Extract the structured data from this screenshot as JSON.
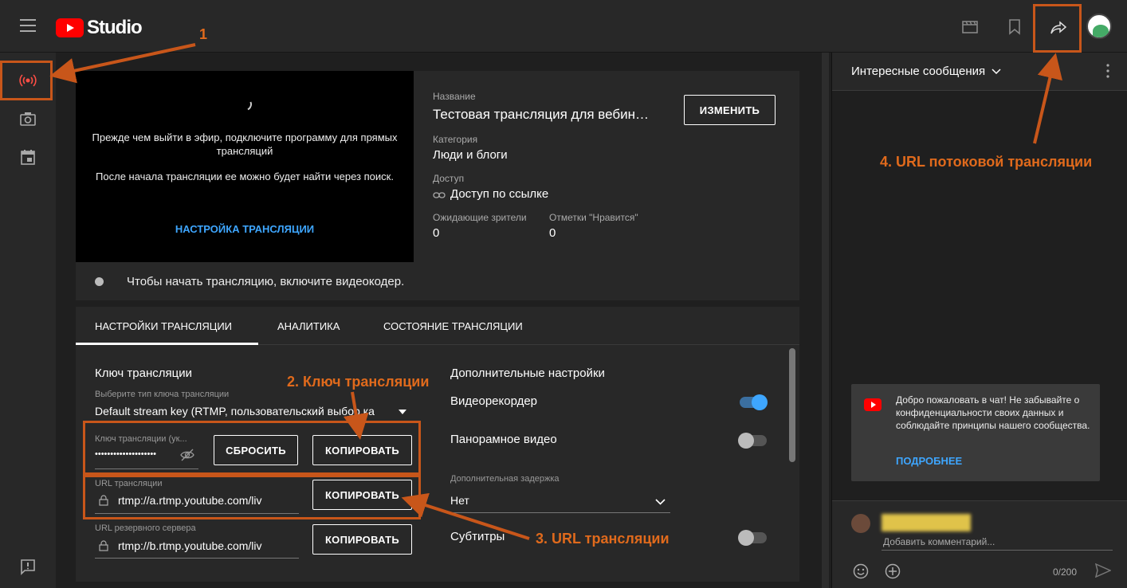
{
  "topbar": {
    "brand": "Studio"
  },
  "preview": {
    "line1": "Прежде чем выйти в эфир, подключите программу для прямых трансляций",
    "line2": "После начала трансляции ее можно будет найти через поиск.",
    "setup_link": "НАСТРОЙКА ТРАНСЛЯЦИИ"
  },
  "meta": {
    "title_label": "Название",
    "title_value": "Тестовая трансляция для вебин…",
    "edit_button": "ИЗМЕНИТЬ",
    "category_label": "Категория",
    "category_value": "Люди и блоги",
    "access_label": "Доступ",
    "access_value": "Доступ по ссылке",
    "waiting_label": "Ожидающие зрители",
    "waiting_value": "0",
    "likes_label": "Отметки \"Нравится\"",
    "likes_value": "0"
  },
  "status": {
    "text": "Чтобы начать трансляцию, включите видеокодер."
  },
  "tabs": [
    "НАСТРОЙКИ ТРАНСЛЯЦИИ",
    "АНАЛИТИКА",
    "СОСТОЯНИЕ ТРАНСЛЯЦИИ"
  ],
  "stream_key": {
    "section_title": "Ключ трансляции",
    "type_label": "Выберите тип ключа трансляции",
    "type_value": "Default stream key (RTMP, пользовательский выбор ка",
    "key_label": "Ключ трансляции (ук...",
    "key_value": "••••••••••••••••••••",
    "reset_button": "СБРОСИТЬ",
    "copy_button": "КОПИРОВАТЬ",
    "url_label": "URL трансляции",
    "url_value": "rtmp://a.rtmp.youtube.com/liv",
    "url_copy_button": "КОПИРОВАТЬ",
    "backup_label": "URL резервного сервера",
    "backup_value": "rtmp://b.rtmp.youtube.com/liv",
    "backup_copy_button": "КОПИРОВАТЬ"
  },
  "extra": {
    "section_title": "Дополнительные настройки",
    "dvr_label": "Видеорекордер",
    "dvr_on": true,
    "panorama_label": "Панорамное видео",
    "panorama_on": false,
    "latency_label": "Дополнительная задержка",
    "latency_value": "Нет",
    "subtitles_label": "Субтитры",
    "subtitles_on": false
  },
  "chat": {
    "title": "Интересные сообщения",
    "welcome_text": "Добро пожаловать в чат! Не забывайте о конфиденциальности своих данных и соблюдайте принципы нашего сообщества.",
    "more_link": "ПОДРОБНЕЕ",
    "comment_placeholder": "Добавить комментарий...",
    "counter": "0/200"
  },
  "annotations": {
    "a1": "1",
    "a2": "2. Ключ трансляции",
    "a3": "3. URL трансляции",
    "a4": "4. URL потоковой трансляции"
  },
  "colors": {
    "accent": "#3ea6ff",
    "annotation": "#c8561a",
    "brand_red": "#ff0000"
  }
}
